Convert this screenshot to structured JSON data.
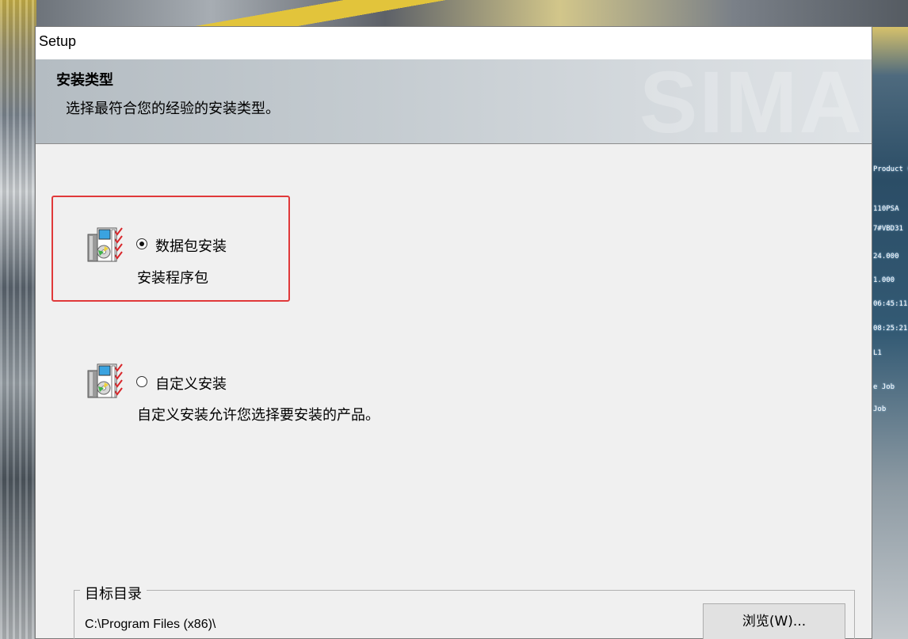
{
  "window": {
    "title": "Setup"
  },
  "banner": {
    "title": "安装类型",
    "subtitle": "选择最符合您的经验的安装类型。",
    "watermark": "SIMA"
  },
  "options": [
    {
      "label": "数据包安装",
      "description": "安装程序包",
      "selected": true,
      "icon": "setup-package-icon"
    },
    {
      "label": "自定义安装",
      "description": "自定义安装允许您选择要安装的产品。",
      "selected": false,
      "icon": "setup-package-icon"
    }
  ],
  "destination": {
    "group_label": "目标目录",
    "path": "C:\\Program Files (x86)\\",
    "browse_label": "浏览(W)..."
  },
  "background_ticker": [
    "Product O",
    "110PSA",
    "7#VBD31",
    "24.000",
    "1.000",
    "06:45:11",
    "08:25:21",
    "L1",
    "e Job",
    "Job"
  ],
  "colors": {
    "highlight_border": "#e0393a",
    "window_bg": "#f0f0f0",
    "banner_bg": "#c4cbd0"
  }
}
